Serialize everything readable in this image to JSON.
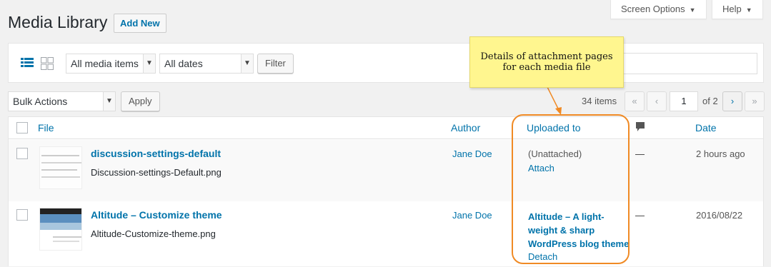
{
  "header": {
    "title": "Media Library",
    "add_new": "Add New",
    "screen_options": "Screen Options",
    "help": "Help"
  },
  "filters": {
    "media_type": "All media items",
    "dates": "All dates",
    "filter_button": "Filter"
  },
  "bulk": {
    "action": "Bulk Actions",
    "apply": "Apply"
  },
  "pagination": {
    "count": "34 items",
    "first": "«",
    "prev": "‹",
    "current": "1",
    "of": "of 2",
    "next": "›",
    "last": "»"
  },
  "columns": {
    "file": "File",
    "author": "Author",
    "uploaded_to": "Uploaded to",
    "comments_icon": "comment-bubble-icon",
    "date": "Date"
  },
  "rows": [
    {
      "title": "discussion-settings-default",
      "filename": "Discussion-settings-Default.png",
      "author": "Jane Doe",
      "uploaded_status": "(Unattached)",
      "uploaded_action": "Attach",
      "comments": "—",
      "date": "2 hours ago"
    },
    {
      "title": "Altitude – Customize theme",
      "filename": "Altitude-Customize-theme.png",
      "author": "Jane Doe",
      "uploaded_parent_line1": "Altitude – A light-",
      "uploaded_parent_line2": "weight & sharp",
      "uploaded_parent_line3": "WordPress blog theme",
      "uploaded_action": "Detach",
      "comments": "—",
      "date": "2016/08/22"
    }
  ],
  "callout": {
    "line1": "Details of attachment pages",
    "line2": "for each media file"
  },
  "colors": {
    "link": "#0073aa",
    "callout_bg": "#fff68f",
    "highlight": "#f08a24"
  }
}
